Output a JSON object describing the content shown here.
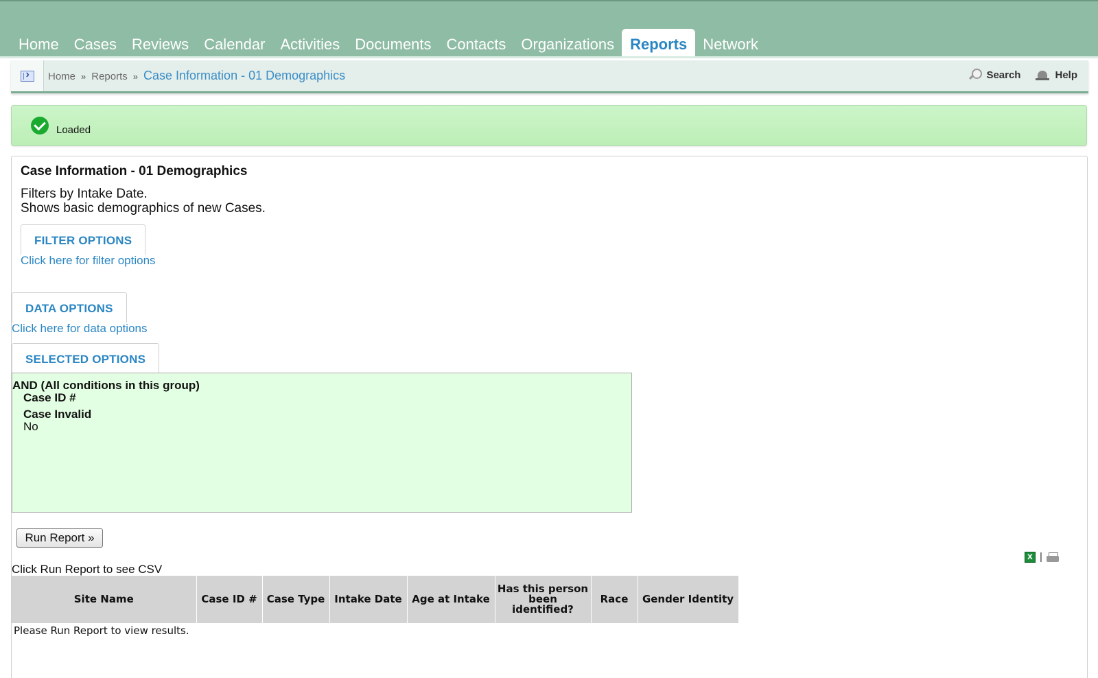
{
  "nav": {
    "tabs": [
      {
        "label": "Home"
      },
      {
        "label": "Cases"
      },
      {
        "label": "Reviews"
      },
      {
        "label": "Calendar"
      },
      {
        "label": "Activities"
      },
      {
        "label": "Documents"
      },
      {
        "label": "Contacts"
      },
      {
        "label": "Organizations"
      },
      {
        "label": "Reports"
      },
      {
        "label": "Network"
      }
    ],
    "active": "Reports"
  },
  "breadcrumb": {
    "items": [
      "Home",
      "Reports"
    ],
    "separator": "»",
    "current": "Case Information - 01 Demographics"
  },
  "tools": {
    "search_label": "Search",
    "help_label": "Help"
  },
  "status": {
    "text": "Loaded"
  },
  "report": {
    "title": "Case Information - 01 Demographics",
    "description_line1": "Filters by Intake Date.",
    "description_line2": "Shows basic demographics of new Cases."
  },
  "filter_options": {
    "tab_label": "FILTER OPTIONS",
    "link_text": "Click here for filter options"
  },
  "data_options": {
    "tab_label": "DATA OPTIONS",
    "link_text": "Click here for data options"
  },
  "selected_options": {
    "tab_label": "SELECTED OPTIONS",
    "group_title": "AND (All conditions in this group)",
    "conditions": [
      {
        "name": "Case ID #",
        "value": ""
      },
      {
        "name": "Case Invalid",
        "value": "No"
      }
    ]
  },
  "run_button_label": "Run Report »",
  "export": {
    "separator": "|"
  },
  "csv_note": "Click Run Report to see CSV",
  "results_table": {
    "columns": [
      "Site Name",
      "Case ID #",
      "Case Type",
      "Intake Date",
      "Age at Intake",
      "Has this person been identified?",
      "Race",
      "Gender Identity"
    ],
    "empty_message": "Please Run Report to view results."
  },
  "colors": {
    "nav_background": "#8fbca4",
    "accent": "#2a86c3",
    "status_background": "#c6f2c2",
    "selected_box_background": "#e3ffe3",
    "table_header": "#d3d3d3"
  }
}
